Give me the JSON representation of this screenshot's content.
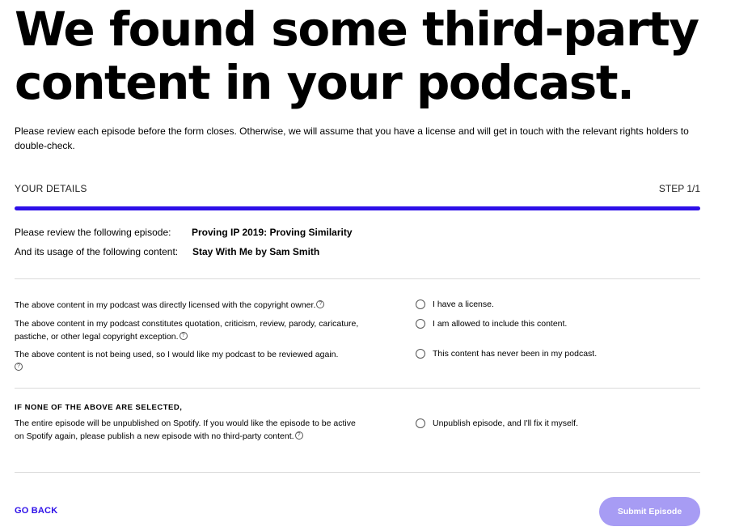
{
  "header": {
    "headline_line1": "We found some third-party",
    "headline_line2": "content in your podcast.",
    "intro": "Please review each episode before the form closes. Otherwise, we will assume that you have a license and will get in touch with the relevant rights holders to double-check."
  },
  "progress": {
    "section_label": "YOUR DETAILS",
    "step_label": "STEP 1/1",
    "fraction": 1.0,
    "accent_color": "#2d0fe8"
  },
  "review": {
    "episode_label": "Please review the following episode:",
    "episode_value": "Proving IP 2019: Proving Similarity",
    "content_label": "And its usage of the following content:",
    "content_value": "Stay With Me by Sam Smith"
  },
  "statements": [
    {
      "text": "The above content in my podcast was directly licensed with the copyright owner.",
      "option": "I have a license."
    },
    {
      "text": "The above content in my podcast constitutes quotation, criticism, review, parody, caricature, pastiche, or other legal copyright exception.",
      "option": "I am allowed to include this content."
    },
    {
      "text": "The above content is not being used, so I would like my podcast to be reviewed again.",
      "option": "This content has never been in my podcast."
    }
  ],
  "none_selected": {
    "heading": "IF NONE OF THE ABOVE ARE SELECTED,",
    "text": "The entire episode will be unpublished on Spotify. If you would like the episode to be active on Spotify again, please publish a new episode with no third-party content.",
    "option": "Unpublish episode, and I'll fix it myself."
  },
  "help_icon": {
    "icon": "question-circle-icon",
    "glyph": "?"
  },
  "footer": {
    "go_back_label": "GO BACK",
    "submit_label": "Submit Episode",
    "submit_color": "#a79cf4"
  }
}
